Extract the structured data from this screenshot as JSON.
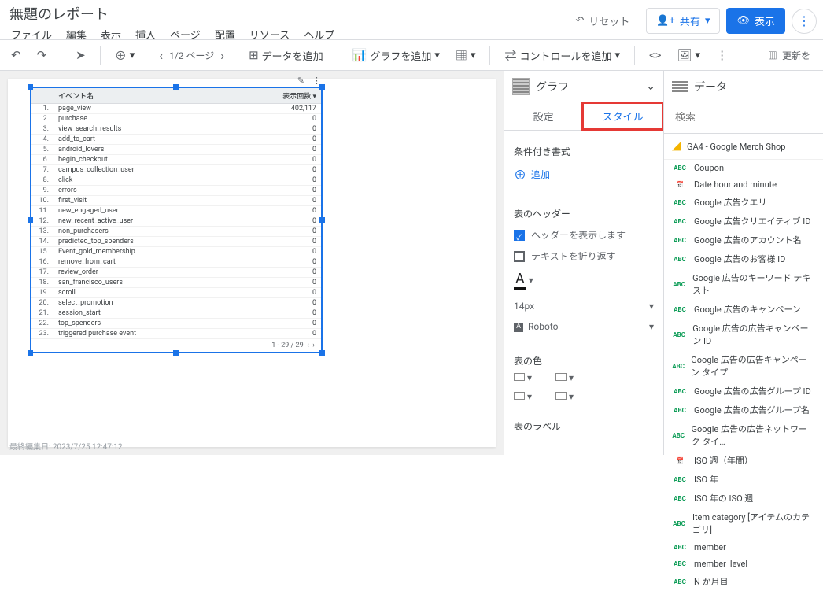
{
  "doc": {
    "title": "無題のレポート",
    "last_edit": "最終編集日: 2023/7/25 12:47:12"
  },
  "menu": {
    "file": "ファイル",
    "edit": "編集",
    "view": "表示",
    "insert": "挿入",
    "page": "ページ",
    "arrange": "配置",
    "resource": "リソース",
    "help": "ヘルプ"
  },
  "actions": {
    "reset": "リセット",
    "share": "共有",
    "display": "表示"
  },
  "toolbar": {
    "pager": "1/2 ページ",
    "add_data": "データを追加",
    "add_chart": "グラフを追加",
    "add_control": "コントロールを追加",
    "refresh": "更新を"
  },
  "table": {
    "col1": "イベント名",
    "col2": "表示回数",
    "rows": [
      {
        "n": "1.",
        "name": "page_view",
        "v": "402,117"
      },
      {
        "n": "2.",
        "name": "purchase",
        "v": "0"
      },
      {
        "n": "3.",
        "name": "view_search_results",
        "v": "0"
      },
      {
        "n": "4.",
        "name": "add_to_cart",
        "v": "0"
      },
      {
        "n": "5.",
        "name": "android_lovers",
        "v": "0"
      },
      {
        "n": "6.",
        "name": "begin_checkout",
        "v": "0"
      },
      {
        "n": "7.",
        "name": "campus_collection_user",
        "v": "0"
      },
      {
        "n": "8.",
        "name": "click",
        "v": "0"
      },
      {
        "n": "9.",
        "name": "errors",
        "v": "0"
      },
      {
        "n": "10.",
        "name": "first_visit",
        "v": "0"
      },
      {
        "n": "11.",
        "name": "new_engaged_user",
        "v": "0"
      },
      {
        "n": "12.",
        "name": "new_recent_active_user",
        "v": "0"
      },
      {
        "n": "13.",
        "name": "non_purchasers",
        "v": "0"
      },
      {
        "n": "14.",
        "name": "predicted_top_spenders",
        "v": "0"
      },
      {
        "n": "15.",
        "name": "Event_gold_membership",
        "v": "0"
      },
      {
        "n": "16.",
        "name": "remove_from_cart",
        "v": "0"
      },
      {
        "n": "17.",
        "name": "review_order",
        "v": "0"
      },
      {
        "n": "18.",
        "name": "san_francisco_users",
        "v": "0"
      },
      {
        "n": "19.",
        "name": "scroll",
        "v": "0"
      },
      {
        "n": "20.",
        "name": "select_promotion",
        "v": "0"
      },
      {
        "n": "21.",
        "name": "session_start",
        "v": "0"
      },
      {
        "n": "22.",
        "name": "top_spenders",
        "v": "0"
      },
      {
        "n": "23.",
        "name": "triggered purchase event",
        "v": "0"
      }
    ],
    "footer": "1 - 29 / 29"
  },
  "panel": {
    "title": "グラフ",
    "tab_setup": "設定",
    "tab_style": "スタイル",
    "cond": "条件付き書式",
    "add": "追加",
    "header_section": "表のヘッダー",
    "show_header": "ヘッダーを表示します",
    "wrap": "テキストを折り返す",
    "font_size": "14px",
    "font_family": "Roboto",
    "color_section": "表の色",
    "label_section": "表のラベル"
  },
  "right": {
    "title": "データ",
    "search_ph": "検索",
    "source": "GA4 - Google Merch Shop",
    "fields": [
      {
        "t": "abc",
        "n": "Coupon"
      },
      {
        "t": "cal",
        "n": "Date hour and minute"
      },
      {
        "t": "abc",
        "n": "Google 広告クエリ"
      },
      {
        "t": "abc",
        "n": "Google 広告クリエイティブ ID"
      },
      {
        "t": "abc",
        "n": "Google 広告のアカウント名"
      },
      {
        "t": "abc",
        "n": "Google 広告のお客様 ID"
      },
      {
        "t": "abc",
        "n": "Google 広告のキーワード テキスト"
      },
      {
        "t": "abc",
        "n": "Google 広告のキャンペーン"
      },
      {
        "t": "abc",
        "n": "Google 広告の広告キャンペーン ID"
      },
      {
        "t": "abc",
        "n": "Google 広告の広告キャンペーン タイプ"
      },
      {
        "t": "abc",
        "n": "Google 広告の広告グループ ID"
      },
      {
        "t": "abc",
        "n": "Google 広告の広告グループ名"
      },
      {
        "t": "abc",
        "n": "Google 広告の広告ネットワーク タイ…"
      },
      {
        "t": "cal",
        "n": "ISO 週（年間）"
      },
      {
        "t": "abc",
        "n": "ISO 年"
      },
      {
        "t": "abc",
        "n": "ISO 年の ISO 週"
      },
      {
        "t": "abc",
        "n": "Item category [アイテムのカテゴリ]"
      },
      {
        "t": "abc",
        "n": "member"
      },
      {
        "t": "abc",
        "n": "member_level"
      },
      {
        "t": "abc",
        "n": "N か月目"
      }
    ]
  },
  "labels": {
    "abc": "ABC",
    "cal": "📅",
    "A": "A",
    "caret": "▾",
    "lar": "‹",
    "rar": "›",
    "plus": "⊕",
    "pen": "✎",
    "dots": "⋮",
    "eye": "👁"
  }
}
